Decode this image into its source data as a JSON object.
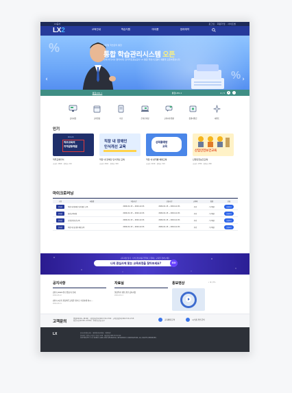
{
  "topbar": {
    "left": "LX공사",
    "right": "로그인 · 회원가입 · 사이트맵"
  },
  "header": {
    "logo_main": "LX",
    "logo_accent": "2",
    "nav": [
      "교육안내",
      "학습지원",
      "마이룸",
      "참여예약",
      "Q"
    ]
  },
  "hero": {
    "sub": "디지털 학습관리 통합",
    "title_a": "통합 학습관리시스템",
    "title_b": "오픈",
    "desc": "언제 어디서나 편리하게, 한국국토정보공사 LX 통합 학습시스템이 새롭게 오픈하였습니다",
    "tabs": [
      "통합LMS 1",
      "통합LMS 2"
    ],
    "counter": "4 / 5"
  },
  "quick": [
    "공지사항",
    "교육일정",
    "수강",
    "온라인과정",
    "교육이수현황",
    "증명서발급",
    "이벤트"
  ],
  "popular": {
    "title": "인기",
    "cards": [
      {
        "badge": "KOLAS",
        "title1": "직무교육의",
        "title2": "지역갈등해결",
        "name": "직무교육지식",
        "meta": "조회수 1849 · 좋아요 219"
      },
      {
        "badge": "",
        "title1": "직장 내 장애인",
        "title2": "인식개선 교육",
        "name": "직장 내 장애인 인식개선 교육",
        "meta": "조회수 2461 · 좋아요 349"
      },
      {
        "badge": "",
        "title1": "성희롱예방",
        "title2": "교육",
        "name": "직장 내 성희롱 예방교육",
        "meta": "조회수 2249 · 좋아요 319"
      },
      {
        "badge": "",
        "title1": "산업안전보건교육",
        "title2": "",
        "name": "산업안전보건교육",
        "meta": "조회수 1789 · 좋아요 298"
      }
    ]
  },
  "micro": {
    "title": "마이크로러닝",
    "headers": [
      "구분",
      "과정명",
      "학습기간",
      "신청기간",
      "교육비",
      "정원",
      "신청"
    ],
    "rows": [
      {
        "type": "온라인",
        "name": "직장 내 장애인 인식개선 교육",
        "period": "2024-01-15 ~ 2024-12-31",
        "apply": "2024-01-15 ~ 2024-12-31",
        "fee": "무료",
        "cap": "/ 무제한",
        "btn": "신청하기"
      },
      {
        "type": "온라인",
        "name": "청렴교육과정",
        "period": "2024-01-15 ~ 2024-12-31",
        "apply": "2024-01-15 ~ 2024-12-31",
        "fee": "무료",
        "cap": "/ 무제한",
        "btn": "신청하기"
      },
      {
        "type": "온라인",
        "name": "산업안전보건교육",
        "period": "2024-01-15 ~ 2024-12-31",
        "apply": "2024-01-15 ~ 2024-12-31",
        "fee": "무료",
        "cap": "/ 무제한",
        "btn": "신청하기"
      },
      {
        "type": "온라인",
        "name": "직장 내 성희롱 예방교육",
        "period": "2024-01-15 ~ 2024-12-31",
        "apply": "2024-01-15 ~ 2024-12-31",
        "fee": "무료",
        "cap": "/ 무제한",
        "btn": "신청하기"
      }
    ]
  },
  "banner2": {
    "small": "교육과정 찾기 · 나의 관심사를 입력하고 원하는 교육을 찾아보세요",
    "text": "나의 관심사에 맞는 교육과정을 찾아보세요?",
    "go": "GO"
  },
  "notices": {
    "col1": {
      "title": "공지사항",
      "items": [
        {
          "t": "[필수] 2024 월 인권교육 안내",
          "d": "2024-03-12"
        },
        {
          "t": "[필수] 1분기 법정의무교육을 필수로 수강하세 하시 ...",
          "d": "2024-03-11"
        }
      ]
    },
    "col2": {
      "title": "자료실",
      "items": [
        {
          "t": "열정학과 실천 관련 공지사항",
          "d": "2024-03-11"
        }
      ]
    },
    "col3": {
      "title": "홍보영상",
      "pager": "‹ 1 / 3 ›"
    }
  },
  "contact": {
    "title": "고객문의",
    "line1": "평일(09:00~18:00) · 학습관리문의 063-713-1700 · 교육신청문의 063-713-1715",
    "line2": "점심시간(12:00~13:00) · 주말/공휴일 휴무",
    "btn1": "교육체제 문의",
    "btn2": "시스템 관련 문의"
  },
  "footer": {
    "logo": "LX",
    "line1": "한국국토정보공사 · 개인정보처리방침 · 이용약관",
    "line2": "전라북도 전주시 덕진구 기지로 120 · 대표전화 063-713-1114",
    "line3": "COPYRIGHT © LX KOREA LAND AND GEOSPATIAL INFORMATIX CORPORATION. ALL RIGHTS RESERVED."
  }
}
